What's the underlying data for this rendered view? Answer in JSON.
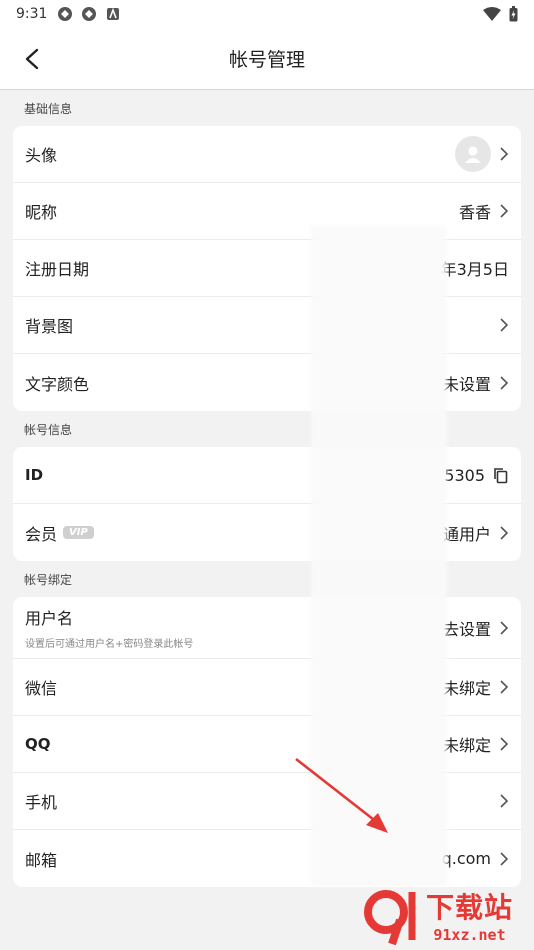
{
  "status": {
    "time": "9:31"
  },
  "header": {
    "title": "帐号管理"
  },
  "sections": [
    {
      "label": "基础信息",
      "rows": [
        {
          "label": "头像",
          "value": ""
        },
        {
          "label": "昵称",
          "value": "香香"
        },
        {
          "label": "注册日期",
          "value": "年3月5日"
        },
        {
          "label": "背景图",
          "value": ""
        },
        {
          "label": "文字颜色",
          "value": "未设置"
        }
      ]
    },
    {
      "label": "帐号信息",
      "rows": [
        {
          "label": "ID",
          "value": "5305"
        },
        {
          "label": "会员",
          "badge": "VIP",
          "value": "通用户"
        }
      ]
    },
    {
      "label": "帐号绑定",
      "rows": [
        {
          "label": "用户名",
          "sub": "设置后可通过用户名+密码登录此帐号",
          "value": "去设置"
        },
        {
          "label": "微信",
          "value": "未绑定"
        },
        {
          "label": "QQ",
          "value": "未绑定"
        },
        {
          "label": "手机",
          "value": ""
        },
        {
          "label": "邮箱",
          "value": "q.com"
        }
      ]
    }
  ],
  "watermark": {
    "text": "下载站",
    "url": "91xz.net"
  },
  "colors": {
    "arrow": "#e53935",
    "watermark": "#e53935"
  }
}
